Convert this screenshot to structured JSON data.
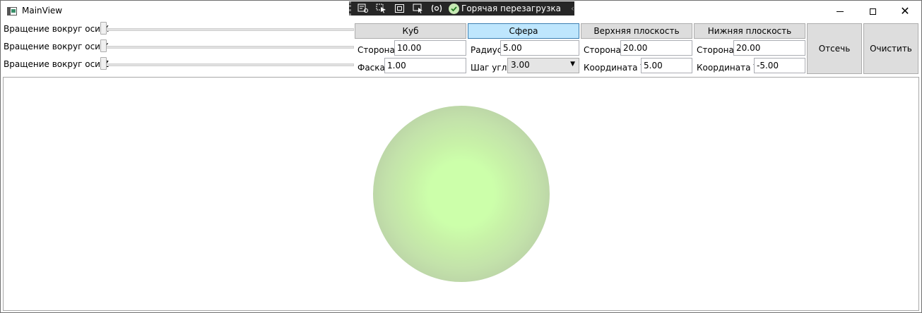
{
  "window": {
    "title": "MainView"
  },
  "debug_toolbar": {
    "hot_reload_label": "Горячая перезагрузка"
  },
  "sliders": [
    {
      "label": "Вращение вокруг оси X",
      "value": 0
    },
    {
      "label": "Вращение вокруг оси Y",
      "value": 0
    },
    {
      "label": "Вращение вокруг оси Z",
      "value": 0
    }
  ],
  "cube": {
    "tab_label": "Куб",
    "side_label": "Сторона",
    "side_value": "10.00",
    "chamfer_label": "Фаска",
    "chamfer_value": "1.00"
  },
  "sphere": {
    "tab_label": "Сфера",
    "radius_label": "Радиус",
    "radius_value": "5.00",
    "angle_step_label": "Шаг угла",
    "angle_step_value": "3.00"
  },
  "top_plane": {
    "tab_label": "Верхняя плоскость",
    "side_label": "Сторона",
    "side_value": "20.00",
    "coord_y_label": "Координата Y",
    "coord_y_value": "5.00"
  },
  "bottom_plane": {
    "tab_label": "Нижняя плоскость",
    "side_label": "Сторона",
    "side_value": "20.00",
    "coord_y_label": "Координата Y",
    "coord_y_value": "-5.00"
  },
  "actions": {
    "cut_label": "Отсечь",
    "clear_label": "Очистить"
  },
  "colors": {
    "active_tab": "#bee6fd",
    "sphere_center": "#ccffaa",
    "sphere_edge": "#a9b8a0"
  }
}
